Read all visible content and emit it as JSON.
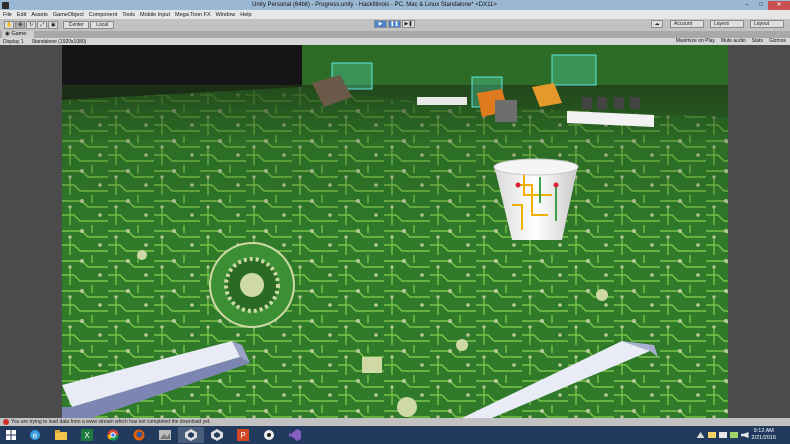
{
  "window": {
    "title": "Unity Personal (64bit) - Progress.unity - HackIllinois - PC, Mac & Linux Standalone* <DX11>",
    "minimize": "–",
    "maximize": "□",
    "close": "✕"
  },
  "menu": [
    "File",
    "Edit",
    "Assets",
    "GameObject",
    "Component",
    "Tools",
    "Mobile Input",
    "Mega Toon FX",
    "Window",
    "Help"
  ],
  "toolbar": {
    "tools": [
      "✋",
      "✥",
      "↻",
      "⤢",
      "▣"
    ],
    "pivot": "Center",
    "space": "Local",
    "play": "▶",
    "pause": "❚❚",
    "step": "▶❚",
    "cloud": "☁",
    "account": "Account",
    "layers": "Layers",
    "layout": "Layout"
  },
  "game_tab": {
    "label": "Game"
  },
  "game_bar": {
    "display": "Display 1",
    "resolution": "Standalone (1920x1080)",
    "maximize_on_play": "Maximize on Play",
    "mute_audio": "Mute audio",
    "stats": "Stats",
    "gizmos": "Gizmos"
  },
  "status": {
    "message": "You are trying to load data from a www stream which has not completed the download yet."
  },
  "taskbar": {
    "apps": [
      "ie",
      "explorer",
      "excel",
      "chrome",
      "firefox",
      "photos",
      "unity",
      "unity-active",
      "powerpoint",
      "media",
      "visual-studio"
    ],
    "time": "9:12 AM",
    "date": "2/21/2016"
  }
}
